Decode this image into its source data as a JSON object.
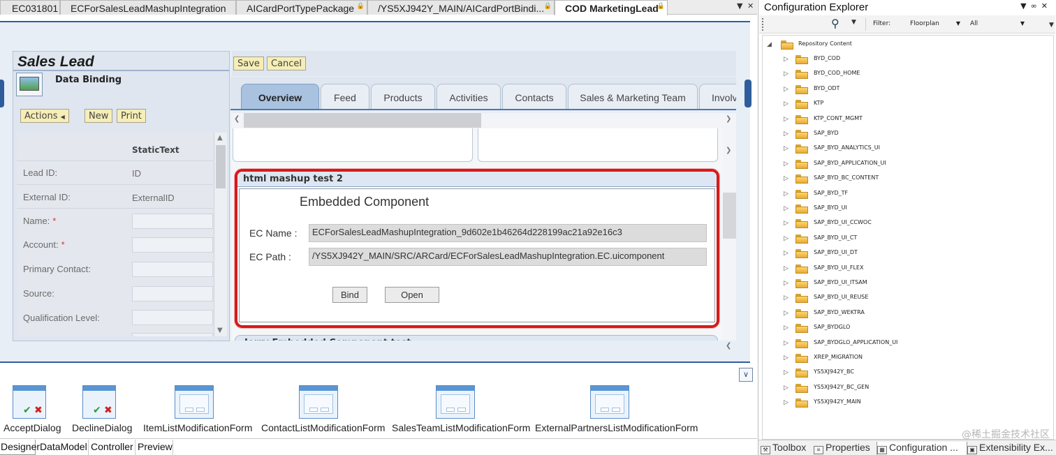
{
  "doc_tabs": [
    {
      "label": "EC031801",
      "active": false
    },
    {
      "label": "ECForSalesLeadMashupIntegration",
      "active": false
    },
    {
      "label": "AICardPortTypePackage",
      "active": false
    },
    {
      "label": "/YS5XJ942Y_MAIN/AICardPortBindi...",
      "active": false
    },
    {
      "label": "COD MarketingLead",
      "active": true
    }
  ],
  "left_panel": {
    "title": "Sales Lead",
    "subtitle": "Data Binding",
    "buttons": {
      "actions": "Actions",
      "new": "New",
      "print": "Print"
    },
    "column_header": "StaticText",
    "fields": [
      {
        "label": "Lead ID:",
        "value": "ID",
        "required": false
      },
      {
        "label": "External ID:",
        "value": "ExternalID",
        "required": false
      },
      {
        "label": "Name:",
        "value": "",
        "required": true
      },
      {
        "label": "Account:",
        "value": "",
        "required": true
      },
      {
        "label": "Primary Contact:",
        "value": "",
        "required": false
      },
      {
        "label": "Source:",
        "value": "",
        "required": false
      },
      {
        "label": "Qualification Level:",
        "value": "",
        "required": false
      }
    ],
    "required_marker": "*"
  },
  "toolbar": {
    "save": "Save",
    "cancel": "Cancel"
  },
  "tabs": [
    "Overview",
    "Feed",
    "Products",
    "Activities",
    "Contacts",
    "Sales & Marketing Team",
    "Involv"
  ],
  "active_tab": "Overview",
  "mashup": {
    "title": "html mashup test 2",
    "component_title": "Embedded Component",
    "ec_name_label": "EC Name :",
    "ec_name_value": "ECForSalesLeadMashupIntegration_9d602e1b46264d228199ac21a92e16c3",
    "ec_path_label": "EC Path :",
    "ec_path_value": "/YS5XJ942Y_MAIN/SRC/ARCard/ECForSalesLeadMashupIntegration.EC.uicomponent",
    "bind_button": "Bind",
    "open_button": "Open"
  },
  "second_component_title": "Jerry Embedded Component test",
  "components": [
    {
      "name": "AcceptDialog",
      "kind": "dialog"
    },
    {
      "name": "DeclineDialog",
      "kind": "dialog"
    },
    {
      "name": "ItemListModificationForm",
      "kind": "form"
    },
    {
      "name": "ContactListModificationForm",
      "kind": "form"
    },
    {
      "name": "SalesTeamListModificationForm",
      "kind": "form"
    },
    {
      "name": "ExternalPartnersListModificationForm",
      "kind": "form"
    }
  ],
  "designer_tabs": [
    "Designer",
    "DataModel",
    "Controller",
    "Preview"
  ],
  "active_designer_tab": "Designer",
  "config_explorer": {
    "title": "Configuration Explorer",
    "filter_label": "Filter:",
    "filter_type": "Floorplan",
    "filter_value": "All",
    "root": "Repository Content",
    "items": [
      "BYD_COD",
      "BYD_COD_HOME",
      "BYD_ODT",
      "KTP",
      "KTP_CONT_MGMT",
      "SAP_BYD",
      "SAP_BYD_ANALYTICS_UI",
      "SAP_BYD_APPLICATION_UI",
      "SAP_BYD_BC_CONTENT",
      "SAP_BYD_TF",
      "SAP_BYD_UI",
      "SAP_BYD_UI_CCWOC",
      "SAP_BYD_UI_CT",
      "SAP_BYD_UI_DT",
      "SAP_BYD_UI_FLEX",
      "SAP_BYD_UI_ITSAM",
      "SAP_BYD_UI_REUSE",
      "SAP_BYD_WEKTRA",
      "SAP_BYDGLO",
      "SAP_BYDGLO_APPLICATION_UI",
      "XREP_MIGRATION",
      "YS5XJ942Y_BC",
      "YS5XJ942Y_BC_GEN",
      "YS5XJ942Y_MAIN"
    ],
    "bottom_tabs": [
      "Toolbox",
      "Properties",
      "Configuration ...",
      "Extensibility Ex..."
    ],
    "active_bottom_tab": "Configuration ..."
  },
  "watermark": "@稀土掘金技术社区"
}
